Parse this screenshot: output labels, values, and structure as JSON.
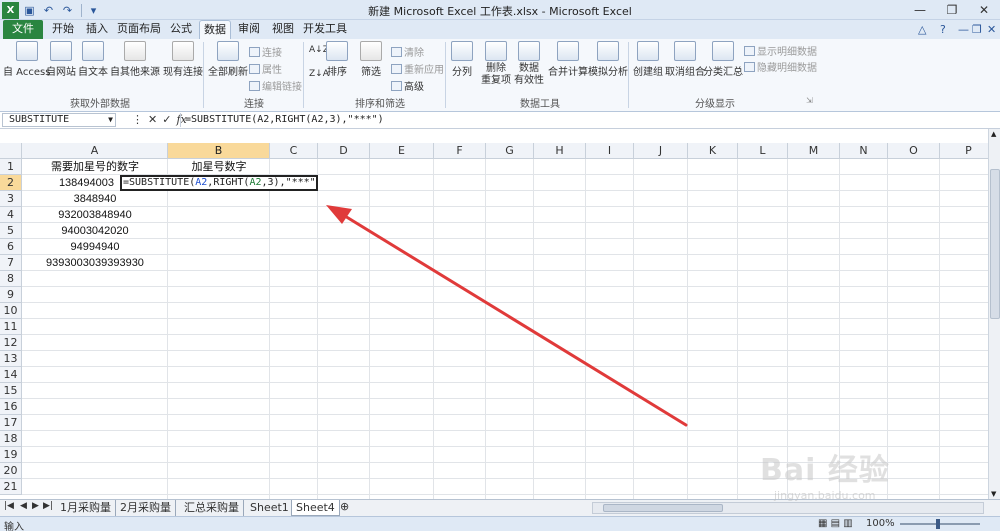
{
  "window": {
    "title": "新建 Microsoft Excel 工作表.xlsx - Microsoft Excel",
    "controls": [
      "—",
      "❐",
      "✕"
    ]
  },
  "ribbon_tabs": [
    "文件",
    "开始",
    "插入",
    "页面布局",
    "公式",
    "数据",
    "审阅",
    "视图",
    "开发工具"
  ],
  "active_tab": "数据",
  "ribbon": {
    "groups": {
      "external": "获取外部数据",
      "connections": "连接",
      "sort_filter": "排序和筛选",
      "data_tools": "数据工具",
      "outline": "分级显示"
    },
    "buttons": {
      "from_access": "自 Access",
      "from_web": "自网站",
      "from_text": "自文本",
      "from_other": "自其他来源",
      "existing_conn": "现有连接",
      "refresh_all": "全部刷新",
      "connections": "连接",
      "properties": "属性",
      "edit_links": "编辑链接",
      "sort": "排序",
      "filter": "筛选",
      "clear": "清除",
      "reapply": "重新应用",
      "advanced": "高级",
      "text_to_columns": "分列",
      "remove_dup_1": "删除",
      "remove_dup_2": "重复项",
      "validation_1": "数据",
      "validation_2": "有效性",
      "consolidate": "合并计算",
      "what_if": "模拟分析",
      "group": "创建组",
      "ungroup": "取消组合",
      "subtotal": "分类汇总",
      "show_detail": "显示明细数据",
      "hide_detail": "隐藏明细数据"
    }
  },
  "formula_bar": {
    "name_box": "SUBSTITUTE",
    "formula": "=SUBSTITUTE(A2,RIGHT(A2,3),\"***\")"
  },
  "columns": [
    "A",
    "B",
    "C",
    "D",
    "E",
    "F",
    "G",
    "H",
    "I",
    "J",
    "K",
    "L",
    "M",
    "N",
    "O",
    "P"
  ],
  "rows": [
    "1",
    "2",
    "3",
    "4",
    "5",
    "6",
    "7",
    "8",
    "9",
    "10",
    "11",
    "12",
    "13",
    "14",
    "15",
    "16",
    "17",
    "18",
    "19",
    "20",
    "21"
  ],
  "cells": {
    "A1": "需要加星号的数字",
    "B1": "加星号数字",
    "A2": "138494003",
    "A3": "3848940",
    "A4": "932003848940",
    "A5": "94003042020",
    "A6": "94994940",
    "A7": "9393003039393930"
  },
  "edit_cell": {
    "part1": "=SUBSTITUTE(",
    "ref1": "A2",
    "part2": ",RIGHT(",
    "ref2": "A2",
    "part3": ",3),\"***\")"
  },
  "sheet_tabs": [
    "1月采购量",
    "2月采购量",
    "汇总采购量",
    "Sheet1",
    "Sheet4"
  ],
  "active_sheet": "Sheet4",
  "status": {
    "mode": "输入",
    "zoom": "100%"
  },
  "watermark": {
    "brand": "Bai 经验",
    "url": "jingyan.baidu.com"
  },
  "colors": {
    "file_tab": "#2a8540",
    "annotation_arrow": "#e03a3a",
    "selected_header": "#f9d99a"
  }
}
